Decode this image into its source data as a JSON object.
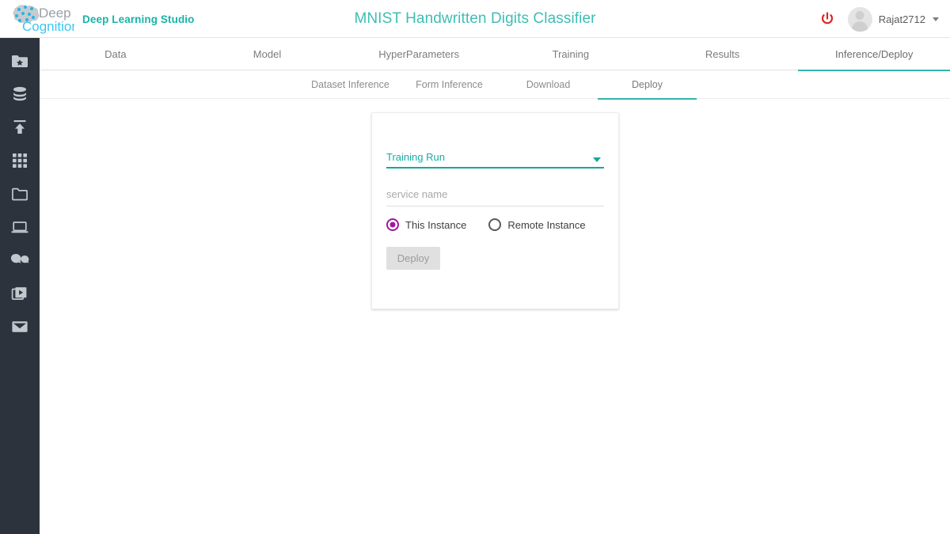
{
  "header": {
    "logo": {
      "word_top": "Deep",
      "word_bottom": "Cognition",
      "icon": "brain-network-logo"
    },
    "brand_name": "Deep Learning Studio",
    "app_title": "MNIST Handwritten Digits Classifier",
    "power_icon": "power-icon",
    "power_color": "#e02020",
    "avatar_icon": "user-avatar-icon",
    "user_name": "Rajat2712",
    "caret_icon": "chevron-down-icon"
  },
  "sidebar": {
    "background": "#2c333d",
    "items": [
      {
        "icon": "folder-star-icon",
        "label": "Projects"
      },
      {
        "icon": "database-icon",
        "label": "Datasets"
      },
      {
        "icon": "upload-icon",
        "label": "Upload"
      },
      {
        "icon": "grid-apps-icon",
        "label": "Apps"
      },
      {
        "icon": "folder-icon",
        "label": "Files"
      },
      {
        "icon": "laptop-icon",
        "label": "Instances"
      },
      {
        "icon": "chat-bubbles-icon",
        "label": "Chat"
      },
      {
        "icon": "video-stack-icon",
        "label": "Tutorials"
      },
      {
        "icon": "envelope-icon",
        "label": "Messages"
      }
    ]
  },
  "main_tabs": {
    "active": "Inference/Deploy",
    "accent": "#35b4ab",
    "items": [
      {
        "label": "Data"
      },
      {
        "label": "Model"
      },
      {
        "label": "HyperParameters"
      },
      {
        "label": "Training"
      },
      {
        "label": "Results"
      },
      {
        "label": "Inference/Deploy"
      }
    ]
  },
  "sub_tabs": {
    "active": "Deploy",
    "items": [
      {
        "label": "Dataset Inference"
      },
      {
        "label": "Form Inference"
      },
      {
        "label": "Download"
      },
      {
        "label": "Deploy"
      }
    ]
  },
  "deploy_form": {
    "training_run_select": {
      "value": "Training Run",
      "caret_icon": "dropdown-caret-icon",
      "accent": "#16a79c"
    },
    "service_name_input": {
      "value": "",
      "placeholder": "service name"
    },
    "instance_radio": {
      "selected": "This Instance",
      "accent": "#9d199d",
      "options": [
        {
          "label": "This Instance"
        },
        {
          "label": "Remote Instance"
        }
      ]
    },
    "deploy_button": {
      "label": "Deploy",
      "disabled": true
    }
  }
}
